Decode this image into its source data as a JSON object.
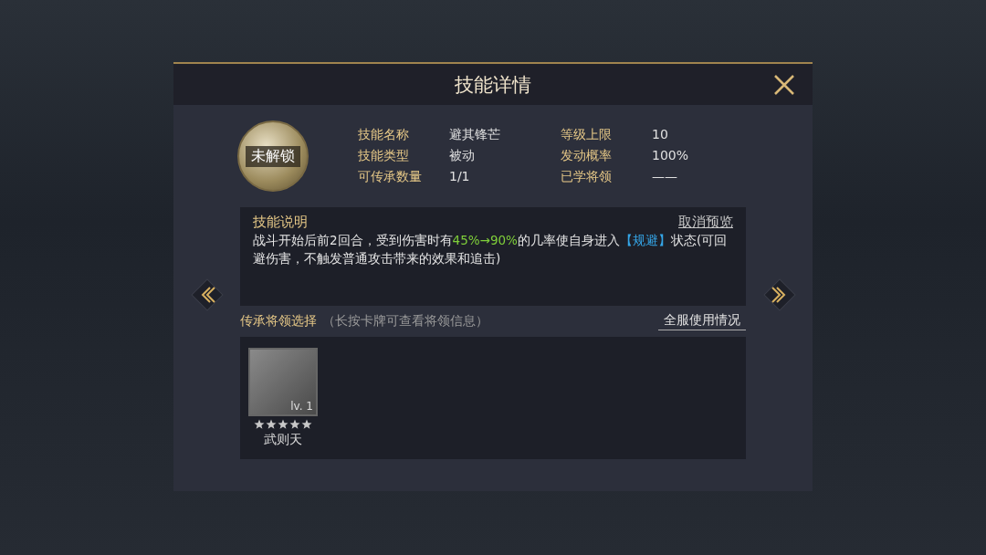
{
  "dialog": {
    "title": "技能详情",
    "skill_badge": {
      "label": "未解锁"
    },
    "info": [
      {
        "label": "技能名称",
        "value": "避其锋芒"
      },
      {
        "label": "等级上限",
        "value": "10"
      },
      {
        "label": "技能类型",
        "value": "被动"
      },
      {
        "label": "发动概率",
        "value": "100%"
      },
      {
        "label": "可传承数量",
        "value": "1/1"
      },
      {
        "label": "已学将领",
        "value": "——"
      }
    ],
    "description": {
      "heading": "技能说明",
      "link": "取消预览",
      "segments": [
        {
          "kind": "plain",
          "text": "战斗开始后前2回合，受到伤害时有"
        },
        {
          "kind": "value",
          "text": "45%→90%"
        },
        {
          "kind": "plain",
          "text": "的几率使自身进入"
        },
        {
          "kind": "keyword",
          "text": "【规避】"
        },
        {
          "kind": "plain",
          "text": "状态(可回避伤害，不触发普通攻击带来的效果和追击)"
        }
      ]
    },
    "selection": {
      "heading": "传承将领选择",
      "hint": "（长按卡牌可查看将领信息）",
      "link": "全服使用情况"
    },
    "generals": [
      {
        "name": "武则天",
        "level": "lv. 1",
        "stars": 5
      }
    ]
  }
}
